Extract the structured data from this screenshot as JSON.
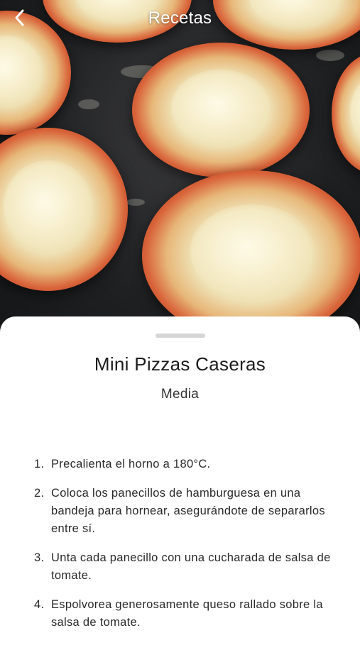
{
  "nav": {
    "title": "Recetas",
    "back_icon": "chevron-left-icon"
  },
  "recipe": {
    "image_alt": "mini-pizzas-photo",
    "title": "Mini Pizzas Caseras",
    "difficulty": "Media",
    "steps": [
      {
        "number": "1.",
        "text": "Precalienta el horno a 180°C."
      },
      {
        "number": "2.",
        "text": "Coloca los panecillos de hamburguesa en una bandeja para hornear, asegurándote de separarlos entre sí."
      },
      {
        "number": "3.",
        "text": "Unta cada panecillo con una cucharada de salsa de tomate."
      },
      {
        "number": "4.",
        "text": "Espolvorea generosamente queso rallado sobre la salsa de tomate."
      }
    ]
  },
  "colors": {
    "sheet_background": "#ffffff",
    "nav_text": "#ffffff",
    "handle": "#d6d6d6"
  }
}
